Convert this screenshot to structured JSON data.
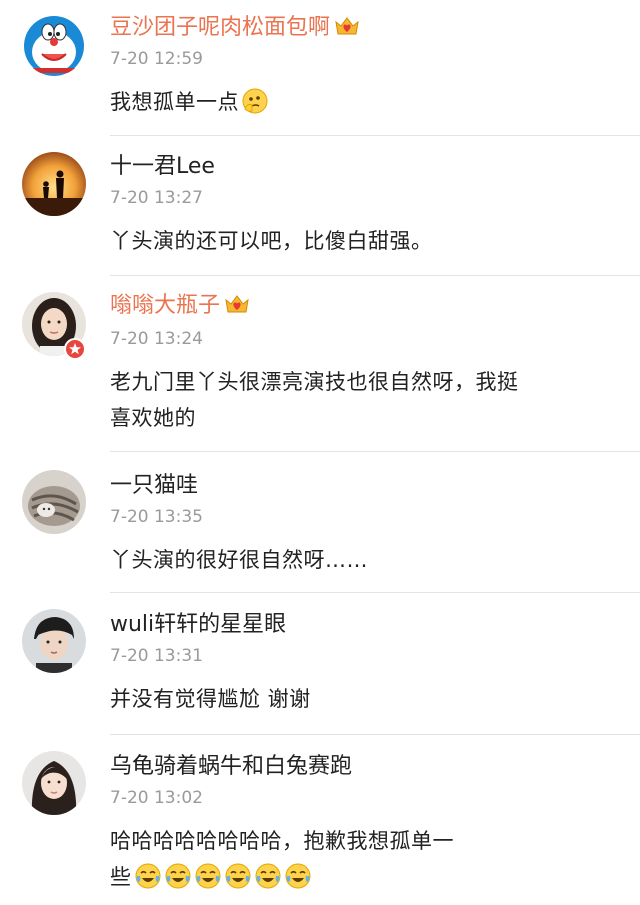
{
  "comments": [
    {
      "name": "豆沙团子呢肉松面包啊",
      "time": "7-20 12:59",
      "text": "我想孤单一点",
      "vip": true
    },
    {
      "name": "十一君Lee",
      "time": "7-20 13:27",
      "text": "丫头演的还可以吧，比傻白甜强。",
      "vip": false
    },
    {
      "name": "嗡嗡大瓶子",
      "time": "7-20 13:24",
      "text_line1": "老九门里丫头很漂亮演技也很自然呀，我挺",
      "text_line2": "喜欢她的",
      "vip": true
    },
    {
      "name": "一只猫哇",
      "time": "7-20 13:35",
      "text": "丫头演的很好很自然呀……",
      "vip": false
    },
    {
      "name": "wuli轩轩的星星眼",
      "time": "7-20 13:31",
      "text": "并没有觉得尴尬 谢谢",
      "vip": false
    },
    {
      "name": "乌龟骑着蜗牛和白兔赛跑",
      "time": "7-20 13:02",
      "text_line1": "哈哈哈哈哈哈哈哈，抱歉我想孤单一",
      "text_line2": "些",
      "vip": false
    }
  ],
  "icons": {
    "vip_crown": "crown-heart-icon",
    "thinking": "thinking-emoji-icon",
    "laugh": "tears-of-joy-emoji-icon",
    "verified": "star-badge-icon"
  },
  "colors": {
    "vip_name": "#eb7350",
    "time": "#9a9a9a",
    "divider": "#e3e3e3"
  }
}
